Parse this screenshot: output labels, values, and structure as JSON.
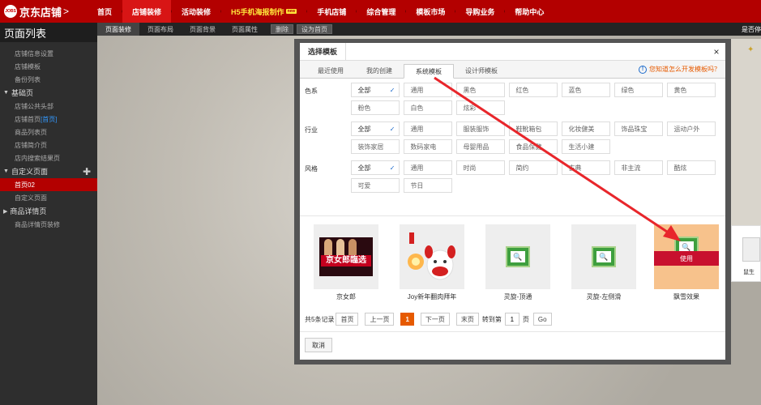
{
  "brand": {
    "logo_text": "JOBS",
    "name": "京东店铺",
    "arrow": ">"
  },
  "topnav": {
    "items": [
      {
        "label": "首页"
      },
      {
        "label": "店铺装修"
      },
      {
        "label": "活动装修"
      },
      {
        "label": "H5手机海报制作",
        "badge": "new"
      },
      {
        "label": "手机店铺"
      },
      {
        "label": "综合管理"
      },
      {
        "label": "模板市场"
      },
      {
        "label": "导购业务"
      },
      {
        "label": "帮助中心"
      }
    ]
  },
  "sidebar": {
    "title": "页面列表",
    "top_items": [
      "店铺信息设置",
      "店铺模板",
      "备份列表"
    ],
    "groups": [
      {
        "label": "基础页",
        "items": [
          "店铺公共头部",
          "店铺首页",
          "商品列表页",
          "店铺简介页",
          "店内搜索结果页"
        ],
        "home_tag": "[首页]"
      },
      {
        "label": "自定义页面",
        "items": [
          "首页02",
          "自定义页面"
        ],
        "selected": "首页02"
      },
      {
        "label": "商品详情页",
        "items": [
          "商品详情页装修"
        ]
      }
    ],
    "collapse_icon": "◀"
  },
  "tabs": {
    "items": [
      "页面装修",
      "页面布局",
      "页面背景",
      "页面属性"
    ],
    "buttons": [
      "删除",
      "设为首页"
    ],
    "right_text": "是否停"
  },
  "modal": {
    "title": "选择模板",
    "close": "×",
    "subtabs": [
      "最近使用",
      "我的创建",
      "系统模板",
      "设计师模板"
    ],
    "active_subtab": "系统模板",
    "help_text": "您知道怎么开发模板吗？",
    "help_icon": "!",
    "filters": [
      {
        "label": "色系",
        "options": [
          "全部",
          "通用",
          "黑色",
          "红色",
          "蓝色",
          "绿色",
          "黄色",
          "粉色",
          "白色",
          "炫彩"
        ]
      },
      {
        "label": "行业",
        "options": [
          "全部",
          "通用",
          "服装服饰",
          "鞋靴箱包",
          "化妆健美",
          "饰品珠宝",
          "运动户外",
          "装饰家居",
          "数码家电",
          "母婴用品",
          "食品保健",
          "生活小建"
        ]
      },
      {
        "label": "风格",
        "options": [
          "全部",
          "通用",
          "时尚",
          "简约",
          "古典",
          "非主流",
          "酷炫",
          "可爱",
          "节日"
        ]
      }
    ],
    "check_mark": "✓",
    "templates": [
      {
        "name": "京女郎",
        "thumb_text": "京女郎臨选"
      },
      {
        "name": "Joy新年翻肉拜年"
      },
      {
        "name": "灵旋-顶通"
      },
      {
        "name": "灵旋-左侧滑"
      },
      {
        "name": "飘雪效果",
        "use_label": "使用"
      }
    ],
    "pager": {
      "summary": "共5条记录",
      "first": "首页",
      "prev": "上一页",
      "current": "1",
      "next": "下一页",
      "last": "末页",
      "goto_label": "转到第",
      "goto_value": "1",
      "page_unit": "页",
      "go": "Go"
    },
    "cancel": "取消"
  },
  "right_panel": {
    "text": "鼠生"
  },
  "colors": {
    "brand_red": "#b30000",
    "accent_orange": "#e65a00",
    "link_blue": "#1c6acb"
  }
}
